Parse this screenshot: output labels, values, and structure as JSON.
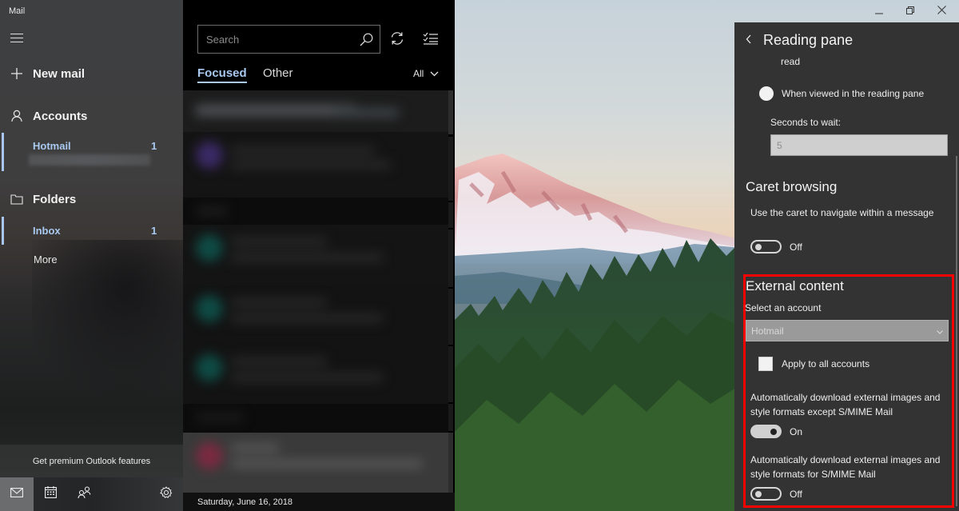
{
  "app": {
    "title": "Mail"
  },
  "nav": {
    "new_mail": "New mail",
    "accounts_label": "Accounts",
    "account": {
      "name": "Hotmail",
      "count": "1"
    },
    "folders_label": "Folders",
    "inbox": {
      "name": "Inbox",
      "count": "1"
    },
    "more": "More",
    "premium": "Get premium Outlook features",
    "bottom_icons": [
      "mail-icon",
      "calendar-icon",
      "people-icon",
      "settings-gear-icon"
    ]
  },
  "list": {
    "search_placeholder": "Search",
    "tabs": {
      "focused": "Focused",
      "other": "Other"
    },
    "filter": "All",
    "date_footer": "Saturday, June 16, 2018",
    "avatar_colors": [
      "#3b2a66",
      "#0f4b45",
      "#0f4b45",
      "#0f4b45",
      "#7a2a40"
    ]
  },
  "window_controls": {
    "minimize": "minimize",
    "restore": "restore",
    "close": "close"
  },
  "settings": {
    "title": "Reading pane",
    "read_fragment": "read",
    "radio_label": "When viewed in the reading pane",
    "seconds_label": "Seconds to wait:",
    "seconds_value": "5",
    "caret": {
      "title": "Caret browsing",
      "description": "Use the caret to navigate within a message",
      "state": "Off"
    },
    "external": {
      "title": "External content",
      "select_label": "Select an account",
      "selected_account": "Hotmail",
      "apply_all": "Apply to all accounts",
      "option1_desc": "Automatically download external images and style formats except S/MIME Mail",
      "option1_state": "On",
      "option2_desc": "Automatically download external images and style formats for S/MIME Mail",
      "option2_state": "Off"
    },
    "highlight_color": "#ff0000"
  }
}
